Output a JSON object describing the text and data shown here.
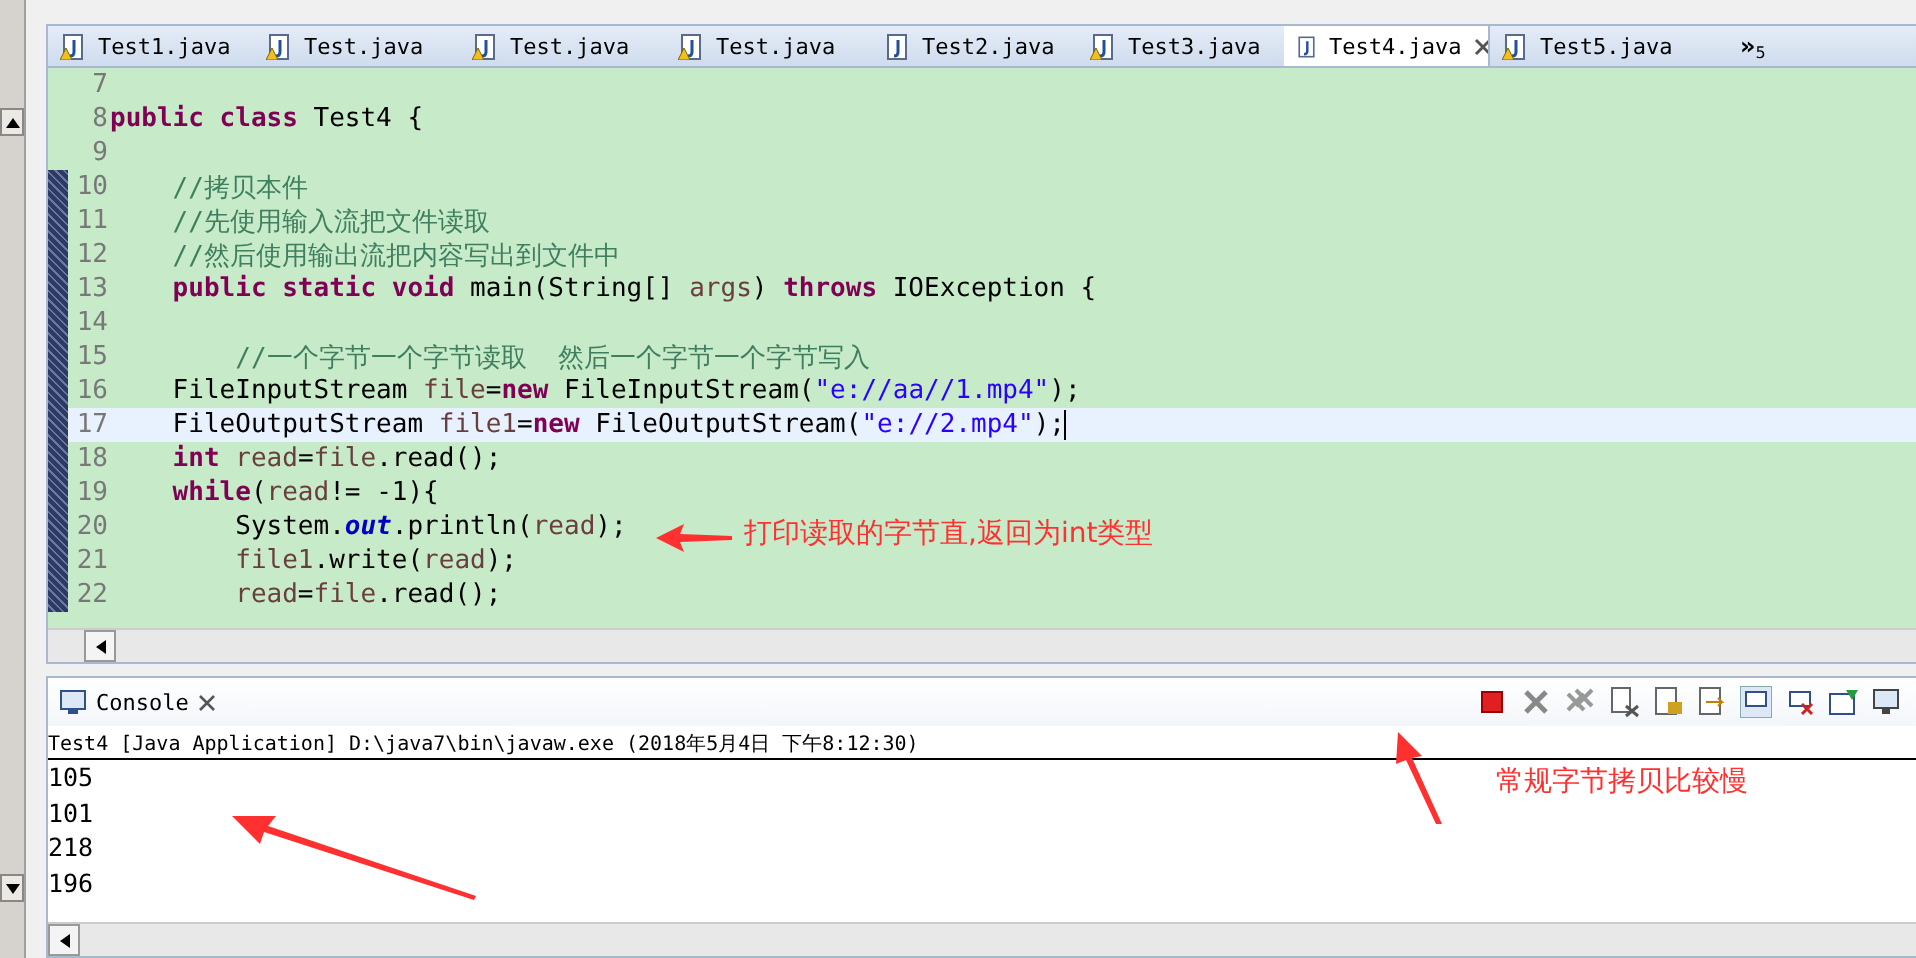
{
  "editor_tabs": [
    {
      "label": "Test1.java",
      "warning": true,
      "selected": false
    },
    {
      "label": "Test.java",
      "warning": true,
      "selected": false
    },
    {
      "label": "Test.java",
      "warning": true,
      "selected": false
    },
    {
      "label": "Test.java",
      "warning": true,
      "selected": false
    },
    {
      "label": "Test2.java",
      "warning": false,
      "selected": false
    },
    {
      "label": "Test3.java",
      "warning": true,
      "selected": false
    },
    {
      "label": "Test4.java",
      "warning": false,
      "selected": true
    },
    {
      "label": "Test5.java",
      "warning": true,
      "selected": false
    }
  ],
  "tabs_overflow": {
    "symbol": "»",
    "count": "5"
  },
  "code_lines": [
    {
      "num": "7",
      "current": false,
      "marked": false
    },
    {
      "num": "8",
      "current": false,
      "marked": false,
      "segments": [
        {
          "text": "public class",
          "kind": "keyword"
        },
        {
          "text": " Test4 {",
          "kind": "plain"
        }
      ]
    },
    {
      "num": "9",
      "current": false,
      "marked": false
    },
    {
      "num": "10",
      "current": false,
      "marked": true,
      "segments": [
        {
          "text": "    //拷贝本件",
          "kind": "comment"
        }
      ]
    },
    {
      "num": "11",
      "current": false,
      "marked": true,
      "segments": [
        {
          "text": "    //先使用输入流把文件读取",
          "kind": "comment"
        }
      ]
    },
    {
      "num": "12",
      "current": false,
      "marked": true,
      "segments": [
        {
          "text": "    //然后使用输出流把内容写出到文件中",
          "kind": "comment"
        }
      ]
    },
    {
      "num": "13",
      "current": false,
      "marked": true,
      "segments": [
        {
          "text": "    public static void",
          "kind": "keyword"
        },
        {
          "text": " main(String[] ",
          "kind": "plain"
        },
        {
          "text": "args",
          "kind": "variable"
        },
        {
          "text": ") ",
          "kind": "plain"
        },
        {
          "text": "throws",
          "kind": "keyword"
        },
        {
          "text": " IOException {",
          "kind": "plain"
        }
      ]
    },
    {
      "num": "14",
      "current": false,
      "marked": true
    },
    {
      "num": "15",
      "current": false,
      "marked": true,
      "segments": [
        {
          "text": "        //一个字节一个字节读取  然后一个字节一个字节写入",
          "kind": "comment"
        }
      ]
    },
    {
      "num": "16",
      "current": false,
      "marked": true,
      "segments": [
        {
          "text": "    FileInputStream ",
          "kind": "plain"
        },
        {
          "text": "file",
          "kind": "variable"
        },
        {
          "text": "=",
          "kind": "plain"
        },
        {
          "text": "new",
          "kind": "keyword"
        },
        {
          "text": " FileInputStream(",
          "kind": "plain"
        },
        {
          "text": "\"e://aa//1.mp4\"",
          "kind": "string"
        },
        {
          "text": ");",
          "kind": "plain"
        }
      ]
    },
    {
      "num": "17",
      "current": true,
      "marked": true,
      "segments": [
        {
          "text": "    FileOutputStream ",
          "kind": "plain"
        },
        {
          "text": "file1",
          "kind": "variable"
        },
        {
          "text": "=",
          "kind": "plain"
        },
        {
          "text": "new",
          "kind": "keyword"
        },
        {
          "text": " FileOutputStream(",
          "kind": "plain"
        },
        {
          "text": "\"e://2.mp4\"",
          "kind": "string"
        },
        {
          "text": ");",
          "kind": "plain"
        }
      ]
    },
    {
      "num": "18",
      "current": false,
      "marked": true,
      "segments": [
        {
          "text": "    int",
          "kind": "keyword"
        },
        {
          "text": " read",
          "kind": "variable"
        },
        {
          "text": "=",
          "kind": "plain"
        },
        {
          "text": "file",
          "kind": "variable"
        },
        {
          "text": ".read();",
          "kind": "plain"
        }
      ]
    },
    {
      "num": "19",
      "current": false,
      "marked": true,
      "segments": [
        {
          "text": "    while",
          "kind": "keyword"
        },
        {
          "text": "(",
          "kind": "plain"
        },
        {
          "text": "read",
          "kind": "variable"
        },
        {
          "text": "!= -1){",
          "kind": "plain"
        }
      ]
    },
    {
      "num": "20",
      "current": false,
      "marked": true,
      "segments": [
        {
          "text": "        System.",
          "kind": "plain"
        },
        {
          "text": "out",
          "kind": "static"
        },
        {
          "text": ".println(",
          "kind": "plain"
        },
        {
          "text": "read",
          "kind": "variable"
        },
        {
          "text": ");",
          "kind": "plain"
        }
      ]
    },
    {
      "num": "21",
      "current": false,
      "marked": true,
      "segments": [
        {
          "text": "        file1",
          "kind": "variable"
        },
        {
          "text": ".write(",
          "kind": "plain"
        },
        {
          "text": "read",
          "kind": "variable"
        },
        {
          "text": ");",
          "kind": "plain"
        }
      ]
    },
    {
      "num": "22",
      "current": false,
      "marked": true,
      "segments": [
        {
          "text": "        read",
          "kind": "variable"
        },
        {
          "text": "=",
          "kind": "plain"
        },
        {
          "text": "file",
          "kind": "variable"
        },
        {
          "text": ".read();",
          "kind": "plain"
        }
      ]
    }
  ],
  "console": {
    "tab": {
      "label": "Console",
      "selected": true
    },
    "launch_info": "Test4 [Java Application] D:\\java7\\bin\\javaw.exe (2018年5月4日 下午8:12:30)",
    "output": [
      "105",
      "101",
      "218",
      "196"
    ]
  },
  "annotations": [
    {
      "text": "打印读取的字节直,返回为int类型"
    },
    {
      "text": "常规字节拷贝比较慢"
    }
  ]
}
